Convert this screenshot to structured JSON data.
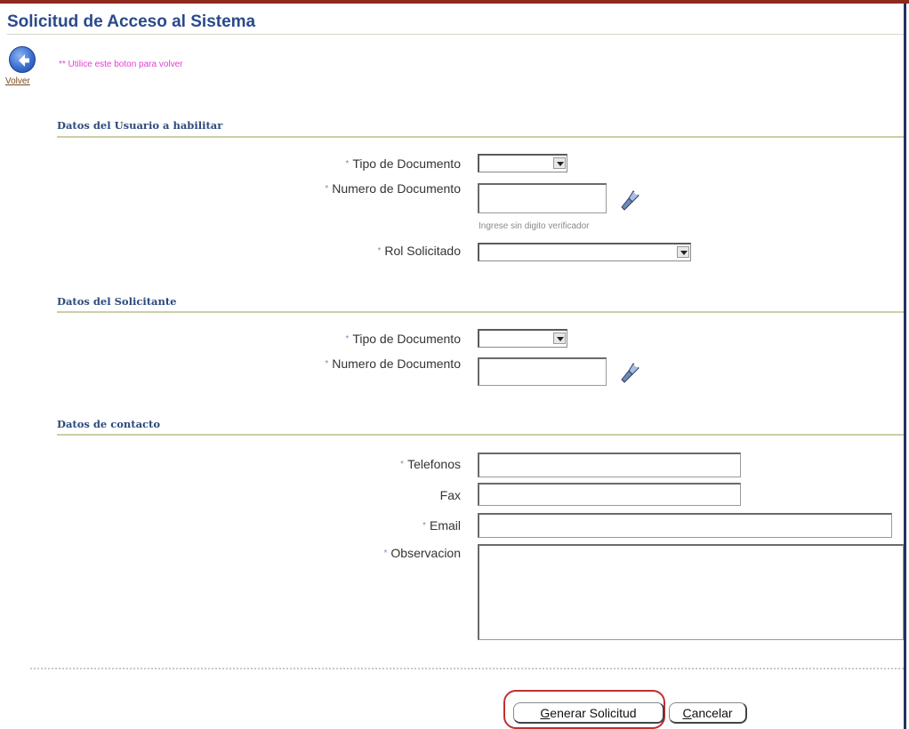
{
  "page": {
    "title": "Solicitud de Acceso al Sistema",
    "back_label": "Volver",
    "back_hint": "** Utilice este boton para volver"
  },
  "sections": {
    "usuario": {
      "title": "Datos del Usuario a habilitar",
      "tipo_doc_label": "Tipo de Documento",
      "tipo_doc_value": "",
      "num_doc_label": "Numero de Documento",
      "num_doc_value": "",
      "num_doc_hint": "Ingrese sin digito verificador",
      "rol_label": "Rol Solicitado",
      "rol_value": ""
    },
    "solicitante": {
      "title": "Datos del Solicitante",
      "tipo_doc_label": "Tipo de Documento",
      "tipo_doc_value": "",
      "num_doc_label": "Numero de Documento",
      "num_doc_value": ""
    },
    "contacto": {
      "title": "Datos de contacto",
      "telefonos_label": "Telefonos",
      "fax_label": "Fax",
      "email_label": "Email",
      "observacion_label": "Observacion"
    }
  },
  "required_marker": "*",
  "buttons": {
    "generar_first": "G",
    "generar_rest": "enerar Solicitud",
    "cancelar_first": "C",
    "cancelar_rest": "ancelar"
  },
  "icons": {
    "back": "back-arrow-icon",
    "search": "flashlight-search-icon"
  },
  "colors": {
    "title": "#2a4a8a",
    "top_bar": "#8c2a1e",
    "hint_pink": "#e040d0",
    "focus_ring": "#c03030"
  }
}
